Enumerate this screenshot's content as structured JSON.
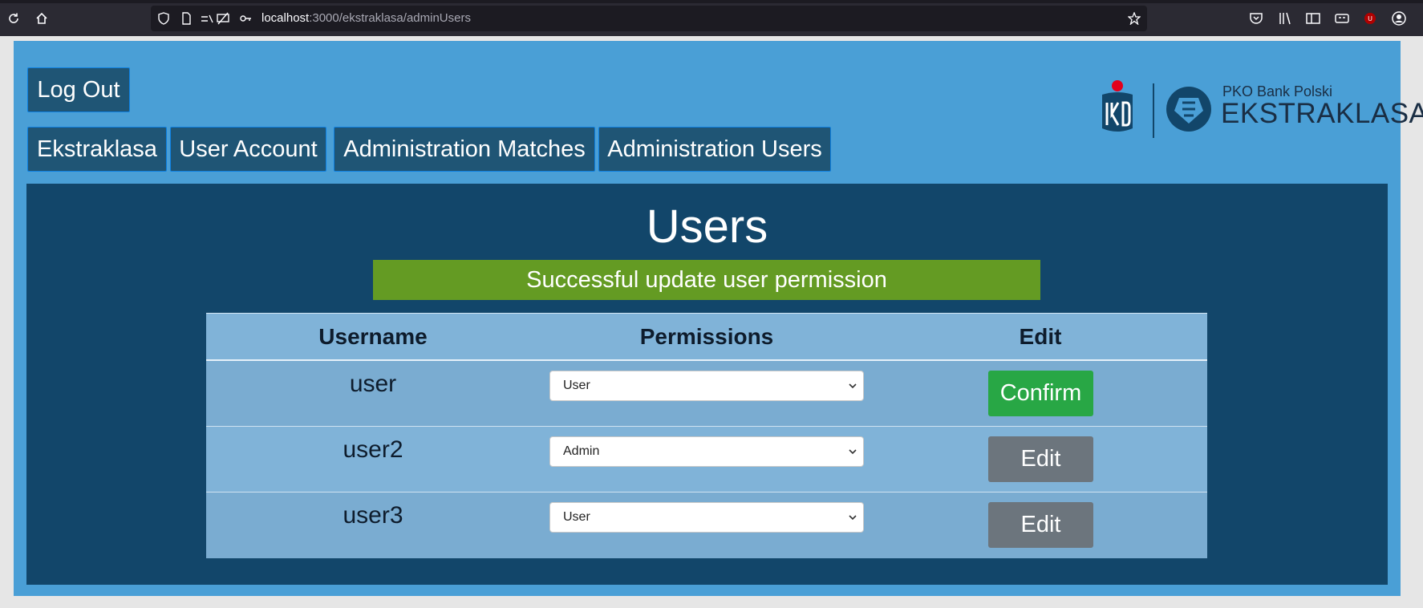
{
  "browser": {
    "url_host": "localhost",
    "url_path": ":3000/ekstraklasa/adminUsers"
  },
  "nav": {
    "logout": "Log Out",
    "items": [
      "Ekstraklasa",
      "User Account",
      "Administration Matches",
      "Administration Users"
    ]
  },
  "logo": {
    "line1": "PKO Bank Polski",
    "line2": "EKSTRAKLASA"
  },
  "panel": {
    "title": "Users",
    "alert": "Successful update user permission"
  },
  "table": {
    "headers": [
      "Username",
      "Permissions",
      "Edit"
    ],
    "rows": [
      {
        "username": "user",
        "permission": "User",
        "action": "Confirm"
      },
      {
        "username": "user2",
        "permission": "Admin",
        "action": "Edit"
      },
      {
        "username": "user3",
        "permission": "User",
        "action": "Edit"
      }
    ]
  },
  "colors": {
    "page_bg": "#4a9fd6",
    "panel_bg": "#12466a",
    "alert_bg": "#649b23",
    "confirm": "#28a745",
    "edit": "#6c757d"
  }
}
